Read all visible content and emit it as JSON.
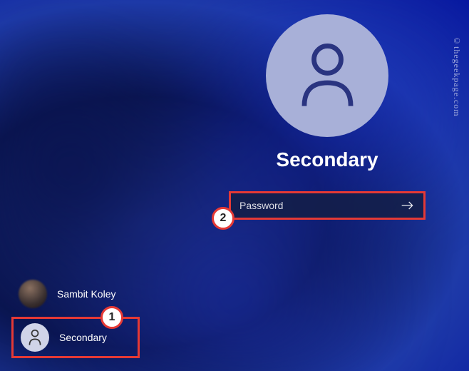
{
  "login": {
    "active_username": "Secondary",
    "password_placeholder": "Password"
  },
  "users": [
    {
      "name": "Sambit Koley",
      "selected": false
    },
    {
      "name": "Secondary",
      "selected": true
    }
  ],
  "annotations": {
    "badge1": "1",
    "badge2": "2"
  },
  "watermark": "©thegeekpage.com"
}
